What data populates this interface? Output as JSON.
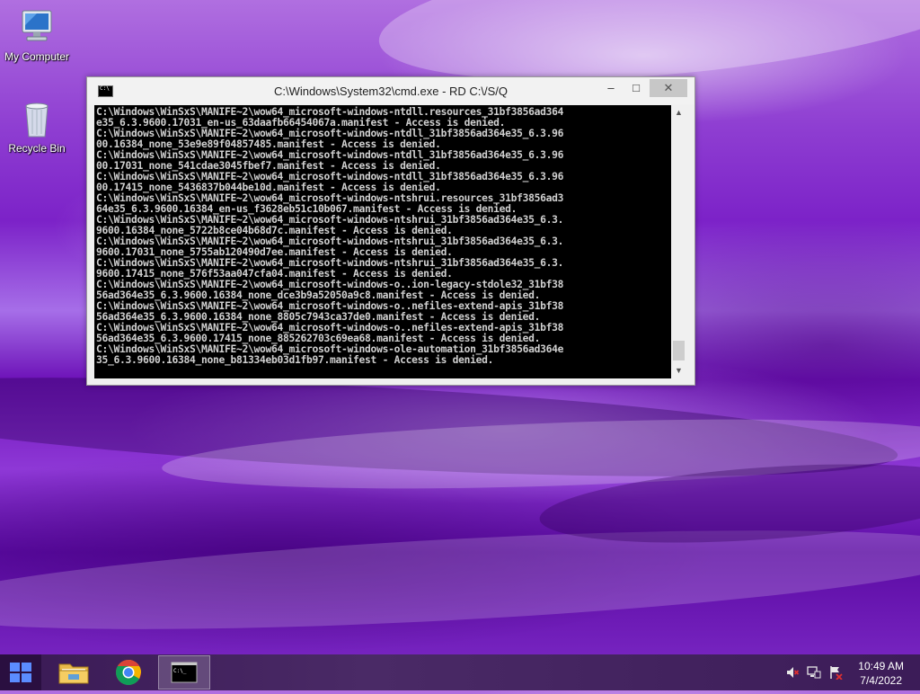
{
  "desktop": {
    "icons": [
      {
        "label": "My Computer",
        "icon": "computer-icon"
      },
      {
        "label": "Recycle Bin",
        "icon": "recycle-bin-icon"
      }
    ]
  },
  "window": {
    "title": "C:\\Windows\\System32\\cmd.exe - RD  C:\\/S/Q",
    "controls": {
      "minimize": "‒",
      "maximize": "□",
      "close": "✕"
    },
    "console_lines": [
      "C:\\Windows\\WinSxS\\MANIFE~2\\wow64_microsoft-windows-ntdll.resources_31bf3856ad364",
      "e35_6.3.9600.17031_en-us_63daafb66454067a.manifest - Access is denied.",
      "C:\\Windows\\WinSxS\\MANIFE~2\\wow64_microsoft-windows-ntdll_31bf3856ad364e35_6.3.96",
      "00.16384_none_53e9e89f04857485.manifest - Access is denied.",
      "C:\\Windows\\WinSxS\\MANIFE~2\\wow64_microsoft-windows-ntdll_31bf3856ad364e35_6.3.96",
      "00.17031_none_541cdae3045fbef7.manifest - Access is denied.",
      "C:\\Windows\\WinSxS\\MANIFE~2\\wow64_microsoft-windows-ntdll_31bf3856ad364e35_6.3.96",
      "00.17415_none_5436837b044be10d.manifest - Access is denied.",
      "C:\\Windows\\WinSxS\\MANIFE~2\\wow64_microsoft-windows-ntshrui.resources_31bf3856ad3",
      "64e35_6.3.9600.16384_en-us_f3628eb51c10b067.manifest - Access is denied.",
      "C:\\Windows\\WinSxS\\MANIFE~2\\wow64_microsoft-windows-ntshrui_31bf3856ad364e35_6.3.",
      "9600.16384_none_5722b8ce04b68d7c.manifest - Access is denied.",
      "C:\\Windows\\WinSxS\\MANIFE~2\\wow64_microsoft-windows-ntshrui_31bf3856ad364e35_6.3.",
      "9600.17031_none_5755ab120490d7ee.manifest - Access is denied.",
      "C:\\Windows\\WinSxS\\MANIFE~2\\wow64_microsoft-windows-ntshrui_31bf3856ad364e35_6.3.",
      "9600.17415_none_576f53aa047cfa04.manifest - Access is denied.",
      "C:\\Windows\\WinSxS\\MANIFE~2\\wow64_microsoft-windows-o..ion-legacy-stdole32_31bf38",
      "56ad364e35_6.3.9600.16384_none_dce3b9a52050a9c8.manifest - Access is denied.",
      "C:\\Windows\\WinSxS\\MANIFE~2\\wow64_microsoft-windows-o..nefiles-extend-apis_31bf38",
      "56ad364e35_6.3.9600.16384_none_8805c7943ca37de0.manifest - Access is denied.",
      "C:\\Windows\\WinSxS\\MANIFE~2\\wow64_microsoft-windows-o..nefiles-extend-apis_31bf38",
      "56ad364e35_6.3.9600.17415_none_885262703c69ea68.manifest - Access is denied.",
      "C:\\Windows\\WinSxS\\MANIFE~2\\wow64_microsoft-windows-ole-automation_31bf3856ad364e",
      "35_6.3.9600.16384_none_b81334eb03d1fb97.manifest - Access is denied."
    ]
  },
  "taskbar": {
    "items": [
      {
        "name": "file-explorer",
        "icon": "folder-icon",
        "active": false
      },
      {
        "name": "chrome",
        "icon": "chrome-icon",
        "active": false
      },
      {
        "name": "cmd",
        "icon": "cmd-icon",
        "active": true
      }
    ],
    "tray": {
      "time": "10:49 AM",
      "date": "7/4/2022",
      "icons": [
        "speaker-muted-icon",
        "network-icon",
        "action-center-icon"
      ]
    }
  }
}
